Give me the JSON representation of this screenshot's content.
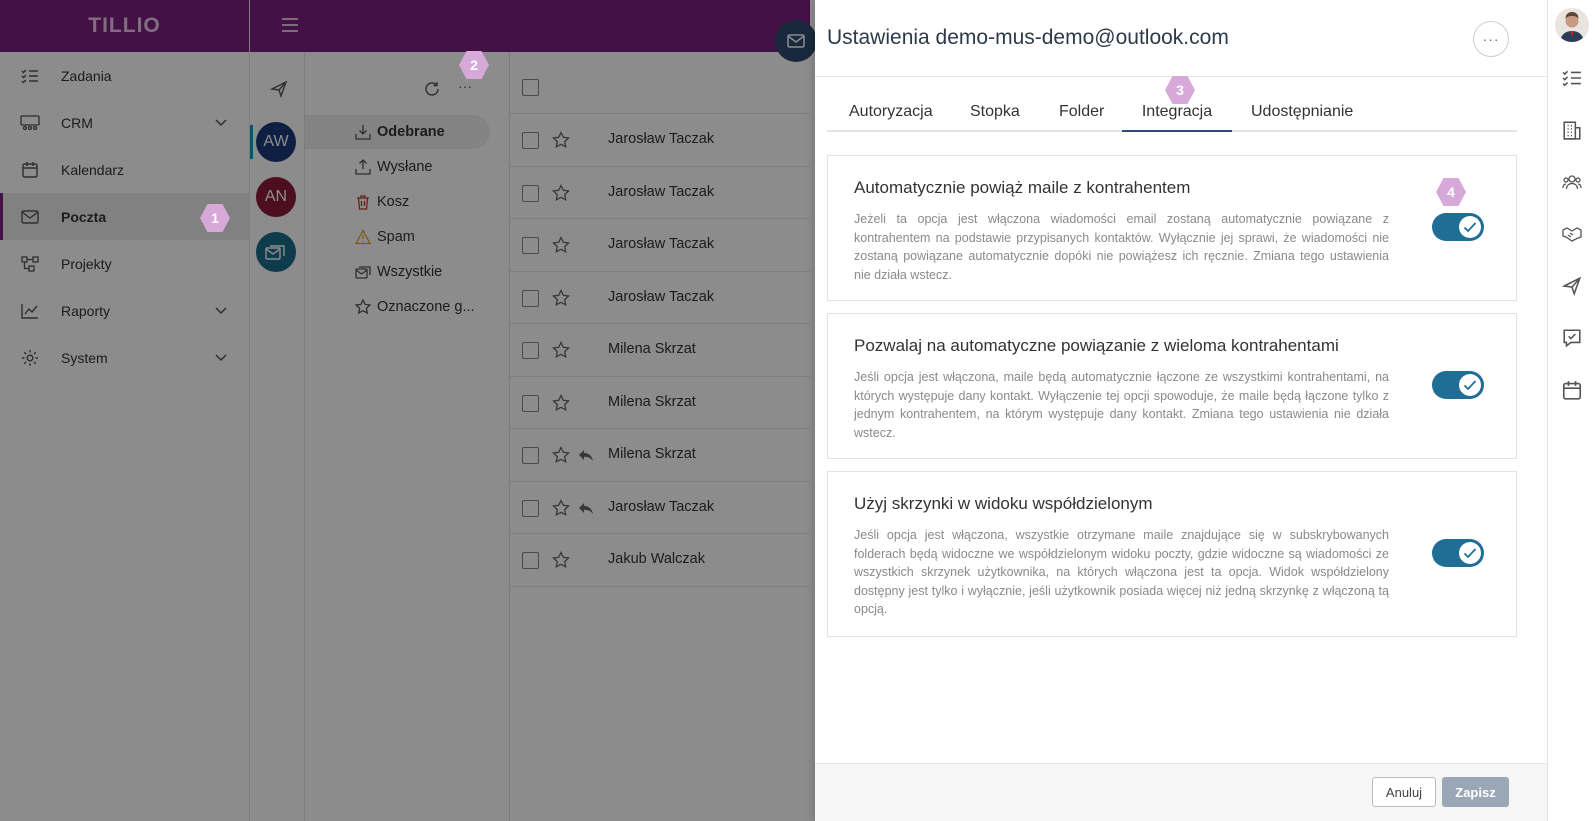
{
  "app": {
    "brand": "TILLIO"
  },
  "sidebar": {
    "items": [
      {
        "label": "Zadania",
        "icon": "tasks-icon"
      },
      {
        "label": "CRM",
        "icon": "crm-icon"
      },
      {
        "label": "Kalendarz",
        "icon": "calendar-icon"
      },
      {
        "label": "Poczta",
        "icon": "mail-icon"
      },
      {
        "label": "Projekty",
        "icon": "projects-icon"
      },
      {
        "label": "Raporty",
        "icon": "reports-icon"
      },
      {
        "label": "System",
        "icon": "gear-icon"
      }
    ]
  },
  "badges": {
    "b1": "1",
    "b2": "2",
    "b3": "3",
    "b4": "4"
  },
  "accounts": [
    {
      "initials": "AW",
      "color": "#1b3a7a"
    },
    {
      "initials": "AN",
      "color": "#8c1a3a"
    },
    {
      "initials": "",
      "color": "#1b6d8c"
    }
  ],
  "folders": [
    {
      "label": "Odebrane",
      "icon": "inbox-icon"
    },
    {
      "label": "Wysłane",
      "icon": "sent-icon"
    },
    {
      "label": "Kosz",
      "icon": "trash-icon"
    },
    {
      "label": "Spam",
      "icon": "warning-icon"
    },
    {
      "label": "Wszystkie",
      "icon": "all-mail-icon"
    },
    {
      "label": "Oznaczone g...",
      "icon": "star-icon"
    }
  ],
  "mails": [
    {
      "sender": "Jarosław Taczak",
      "replied": false
    },
    {
      "sender": "Jarosław Taczak",
      "replied": false
    },
    {
      "sender": "Jarosław Taczak",
      "replied": false
    },
    {
      "sender": "Jarosław Taczak",
      "replied": false
    },
    {
      "sender": "Milena Skrzat",
      "replied": false
    },
    {
      "sender": "Milena Skrzat",
      "replied": false
    },
    {
      "sender": "Milena Skrzat",
      "replied": true
    },
    {
      "sender": "Jarosław Taczak",
      "replied": true
    },
    {
      "sender": "Jakub Walczak",
      "replied": false
    }
  ],
  "panel": {
    "title": "Ustawienia demo-mus-demo@outlook.com",
    "more_label": "···",
    "tabs": [
      "Autoryzacja",
      "Stopka",
      "Folder",
      "Integracja",
      "Udostępnianie"
    ],
    "active_tab": "Integracja",
    "cards": [
      {
        "title": "Automatycznie powiąż maile z kontrahentem",
        "desc": "Jeżeli ta opcja jest włączona wiadomości email zostaną automatycznie powiązane z kontrahentem na podstawie przypisanych kontaktów. Wyłącznie jej sprawi, że wiadomości nie zostaną powiązane automatycznie dopóki nie powiążesz ich ręcznie. Zmiana tego ustawienia nie działa wstecz.",
        "enabled": true
      },
      {
        "title": "Pozwalaj na automatyczne powiązanie z wieloma kontrahentami",
        "desc": "Jeśli opcja jest włączona, maile będą automatycznie łączone ze wszystkimi kontrahentami, na których występuje dany kontakt. Wyłączenie tej opcji spowoduje, że maile będą łączone tylko z jednym kontrahentem, na którym występuje dany kontakt. Zmiana tego ustawienia nie działa wstecz.",
        "enabled": true
      },
      {
        "title": "Użyj skrzynki w widoku współdzielonym",
        "desc": "Jeśli opcja jest włączona, wszystkie otrzymane maile znajdujące się w subskrybowanych folderach będą widoczne we współdzielonym widoku poczty, gdzie widoczne są wiadomości ze wszystkich skrzynek użytkownika, na których włączona jest ta opcja. Widok współdzielony dostępny jest tylko i wyłącznie, jeśli użytkownik posiada więcej niż jedną skrzynkę z włączoną tą opcją.",
        "enabled": true
      }
    ],
    "footer": {
      "cancel": "Anuluj",
      "save": "Zapisz"
    }
  },
  "colors": {
    "brand": "#7a1f7e",
    "toggle": "#1f6e96",
    "badge": "#d7a9d8"
  }
}
